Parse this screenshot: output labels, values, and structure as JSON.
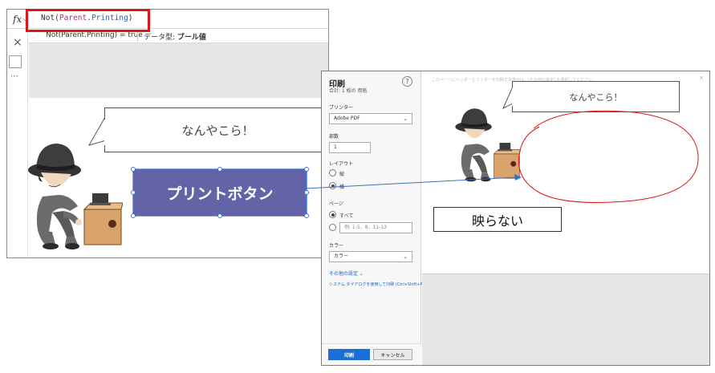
{
  "editor": {
    "formula_bar": {
      "fx_label": "fx",
      "chevron": "⌵",
      "formula_parts": [
        "Not(",
        "Parent",
        ".",
        "Printing",
        ")"
      ],
      "result_expression": "Not(Parent.Printing) = true",
      "result_type_label": "データ型:",
      "result_type_value": "ブール値"
    },
    "left_rail": {
      "close_icon": "×",
      "more_dots": "⋯"
    },
    "canvas": {
      "bubble_text": "なんやこら！",
      "print_button_label": "プリントボタン"
    }
  },
  "print_dialog": {
    "title": "印刷",
    "subtitle": "合計: 1 枚の 用紙",
    "help_icon": "?",
    "printer_label": "プリンター",
    "printer_value": "Adobe PDF",
    "copies_label": "部数",
    "copies_value": "1",
    "layout_label": "レイアウト",
    "layout_options": [
      "縦",
      "横"
    ],
    "layout_selected": "横",
    "pages_label": "ページ",
    "pages_options": [
      "すべて"
    ],
    "pages_selected": "すべて",
    "pages_placeholder": "例: 1-5、8、11-13",
    "color_label": "カラー",
    "color_value": "カラー",
    "more_settings": "その他の設定",
    "system_dialog_link": "システム ダイアログを使用して印刷 (Ctrl+Shift+P)",
    "print_button": "印刷",
    "cancel_button": "キャンセル",
    "preview": {
      "top_text": "このページにヘッダーとフッターを印刷する場合は、[その他の設定] を選択してください。",
      "close_glyph": "×",
      "bubble_text": "なんやこら！"
    }
  },
  "annotation": {
    "callout_text": "映らない",
    "highlight_color": "#e01515",
    "arrow_color": "#3a6fc4"
  },
  "colors": {
    "print_button_bg": "#6264a7",
    "dialog_primary": "#1a6ed8"
  }
}
